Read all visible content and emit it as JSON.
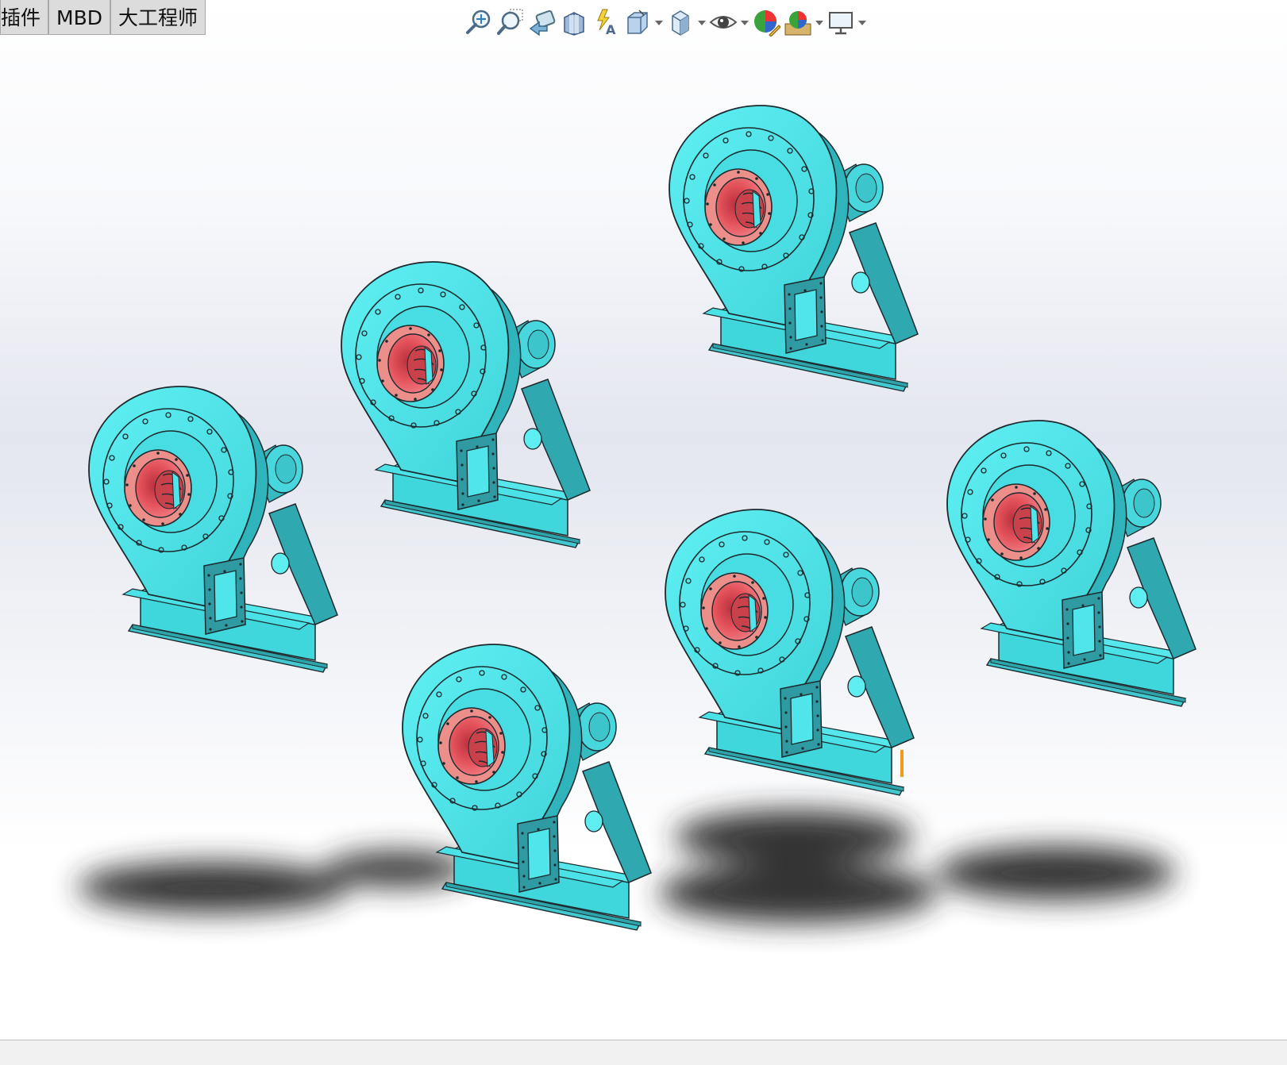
{
  "tabs": [
    {
      "label": "插件"
    },
    {
      "label": "MBD"
    },
    {
      "label": "大工程师"
    }
  ],
  "toolbar": {
    "items": [
      {
        "icon": "zoom-to-fit-icon",
        "dropdown": false
      },
      {
        "icon": "zoom-to-area-icon",
        "dropdown": false
      },
      {
        "icon": "previous-view-icon",
        "dropdown": false
      },
      {
        "icon": "section-view-icon",
        "dropdown": false
      },
      {
        "icon": "dynamic-annotation-views-icon",
        "dropdown": false
      },
      {
        "icon": "view-orientation-icon",
        "dropdown": true
      },
      {
        "icon": "display-style-icon",
        "dropdown": true
      },
      {
        "icon": "hide-show-items-icon",
        "dropdown": true
      },
      {
        "icon": "edit-appearance-icon",
        "dropdown": false
      },
      {
        "icon": "apply-scene-icon",
        "dropdown": true
      },
      {
        "icon": "view-settings-icon",
        "dropdown": true
      }
    ]
  },
  "scene": {
    "model": "centrifugal-fan",
    "instance_count": 6,
    "colors": {
      "housing": "#4fe8ec",
      "housing_side": "#37b6bd",
      "inlet_flange": "#ec8f8a",
      "inlet_bore": "#e4525b",
      "edge": "#1c2a2e",
      "shadow": "#2b2b2b"
    }
  }
}
